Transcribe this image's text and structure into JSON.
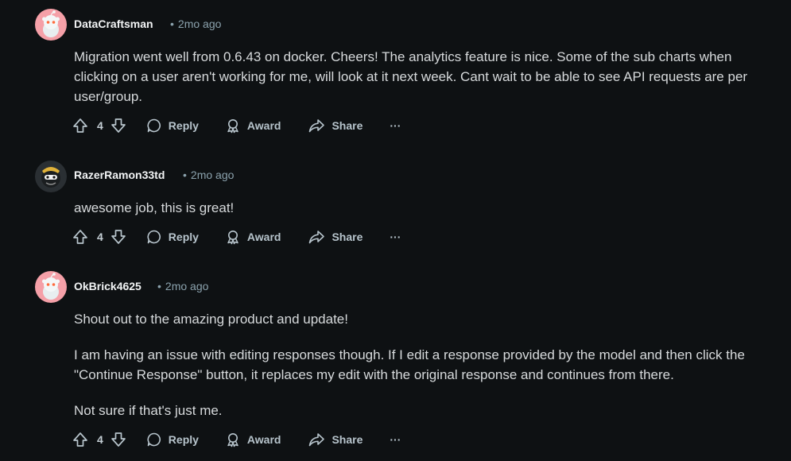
{
  "comments": [
    {
      "username": "DataCraftsman",
      "time": "2mo ago",
      "avatar": "snoo-pink",
      "paragraphs": [
        "Migration went well from 0.6.43 on docker. Cheers! The analytics feature is nice. Some of the sub charts when clicking on a user aren't working for me, will look at it next week. Cant wait to be able to see API requests are per user/group."
      ],
      "votes": "4"
    },
    {
      "username": "RazerRamon33td",
      "time": "2mo ago",
      "avatar": "dark-cartoon",
      "paragraphs": [
        "awesome job, this is great!"
      ],
      "votes": "4"
    },
    {
      "username": "OkBrick4625",
      "time": "2mo ago",
      "avatar": "snoo-pink",
      "paragraphs": [
        "Shout out to the amazing product and update!",
        "I am having an issue with editing responses though. If I edit a response provided by the model and then click the \"Continue Response\" button, it replaces my edit with the original response and continues from there.",
        "Not sure if that's just me."
      ],
      "votes": "4"
    }
  ],
  "actions": {
    "reply_label": "Reply",
    "award_label": "Award",
    "share_label": "Share",
    "more_label": "···",
    "separator": "•"
  },
  "colors": {
    "background": "#0e1113",
    "avatar_pink": "#f5a0a8",
    "text": "#d7dadc",
    "muted": "#8ba2ad"
  }
}
